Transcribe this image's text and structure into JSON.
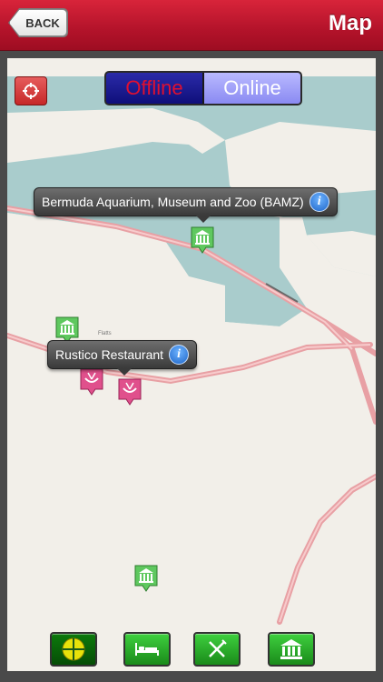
{
  "header": {
    "back_label": "BACK",
    "title": "Map"
  },
  "map": {
    "segmented": {
      "offline_label": "Offline",
      "online_label": "Online",
      "selected": "Offline"
    },
    "callouts": [
      {
        "title": "Bermuda Aquarium, Museum and Zoo (BAMZ)",
        "category": "attraction"
      },
      {
        "title": "Rustico Restaurant",
        "category": "restaurant"
      }
    ],
    "place_labels": [
      "Flatts"
    ],
    "markers": [
      {
        "category": "attraction",
        "icon": "museum-icon"
      },
      {
        "category": "attraction",
        "icon": "museum-icon"
      },
      {
        "category": "restaurant",
        "icon": "restaurant-icon"
      },
      {
        "category": "restaurant",
        "icon": "restaurant-icon"
      },
      {
        "category": "attraction",
        "icon": "museum-icon"
      }
    ],
    "colors": {
      "water": "#a9cccc",
      "land": "#f2efe9",
      "road": "#e8a0a4",
      "attraction_marker": "#5fc85f",
      "restaurant_marker": "#e0508c"
    }
  },
  "toolbar": {
    "buttons": [
      {
        "name": "all-places",
        "icon": "crosshair-icon",
        "active": true
      },
      {
        "name": "hotels",
        "icon": "bed-icon",
        "active": false
      },
      {
        "name": "restaurants",
        "icon": "fork-knife-icon",
        "active": false
      },
      {
        "name": "attractions",
        "icon": "museum-icon",
        "active": false
      }
    ]
  }
}
